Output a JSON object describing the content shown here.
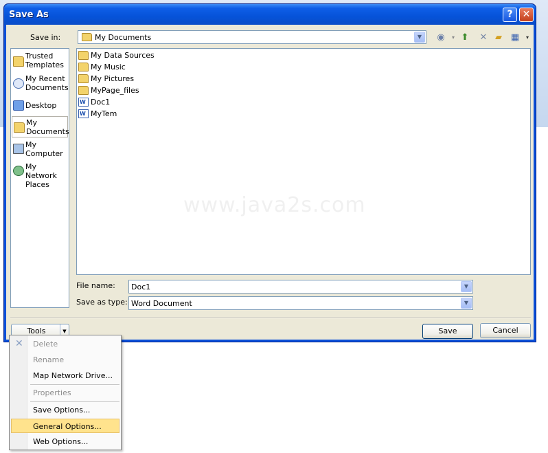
{
  "dialog": {
    "title": "Save As",
    "help": "?",
    "close": "✕"
  },
  "save_in": {
    "label": "Save in:",
    "value": "My Documents"
  },
  "toolbar_icons": [
    "back-icon",
    "up-folder-icon",
    "delete-icon",
    "new-folder-icon",
    "views-icon"
  ],
  "places": [
    {
      "name": "trusted-templates",
      "label": "Trusted Templates"
    },
    {
      "name": "my-recent-documents",
      "label": "My Recent Documents"
    },
    {
      "name": "desktop",
      "label": "Desktop"
    },
    {
      "name": "my-documents",
      "label": "My Documents"
    },
    {
      "name": "my-computer",
      "label": "My Computer"
    },
    {
      "name": "my-network-places",
      "label": "My Network Places"
    }
  ],
  "files": [
    {
      "name": "My Data Sources",
      "icon": "data-folder-icon"
    },
    {
      "name": "My Music",
      "icon": "music-folder-icon"
    },
    {
      "name": "My Pictures",
      "icon": "pictures-folder-icon"
    },
    {
      "name": "MyPage_files",
      "icon": "folder-icon"
    },
    {
      "name": "Doc1",
      "icon": "word-doc-icon"
    },
    {
      "name": "MyTem",
      "icon": "word-doc-icon"
    }
  ],
  "watermark": "www.java2s.com",
  "file_name": {
    "label": "File name:",
    "value": "Doc1"
  },
  "save_as_type": {
    "label": "Save as type:",
    "value": "Word Document"
  },
  "buttons": {
    "tools": "Tools",
    "save": "Save",
    "cancel": "Cancel"
  },
  "tools_menu": [
    {
      "label": "Delete",
      "disabled": true
    },
    {
      "label": "Rename",
      "disabled": true
    },
    {
      "label": "Map Network Drive...",
      "disabled": false
    },
    {
      "label": "Properties",
      "disabled": true
    },
    {
      "label": "Save Options...",
      "disabled": false
    },
    {
      "label": "General Options...",
      "disabled": false,
      "highlighted": true
    },
    {
      "label": "Web Options...",
      "disabled": false
    }
  ],
  "colors": {
    "titlebar": "#0653d9",
    "client": "#ece9d8",
    "menu_highlight": "#ffe38d"
  }
}
